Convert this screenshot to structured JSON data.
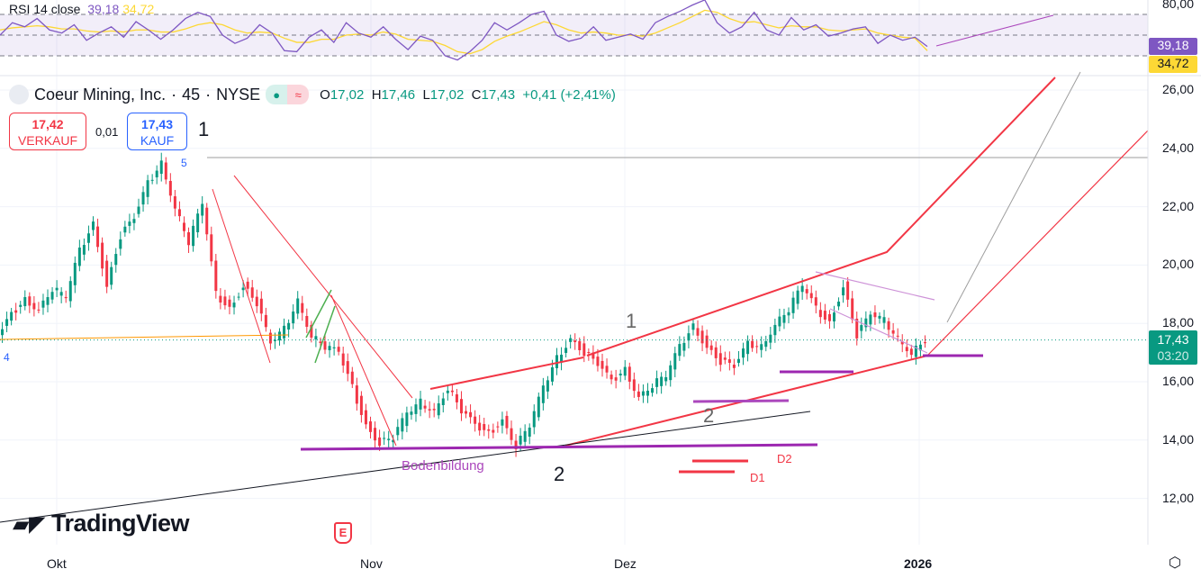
{
  "header": {
    "symbol": "Coeur Mining, Inc.",
    "interval": "45",
    "exchange": "NYSE",
    "separator": "·",
    "ohlc": {
      "o_label": "O",
      "o": "17,02",
      "h_label": "H",
      "h": "17,46",
      "l_label": "L",
      "l": "17,02",
      "c_label": "C",
      "c": "17,43",
      "change": "+0,41 (+2,41%)"
    }
  },
  "trade": {
    "sell_price": "17,42",
    "sell_label": "VERKAUF",
    "spread": "0,01",
    "buy_price": "17,43",
    "buy_label": "KAUF"
  },
  "rsi": {
    "title": "RSI 14 close",
    "value": "39,18",
    "ma": "34,72",
    "axis_top": "80,00",
    "levels": [
      70,
      50,
      30
    ],
    "values": [
      50,
      62,
      58,
      66,
      55,
      52,
      60,
      45,
      52,
      58,
      48,
      63,
      55,
      46,
      55,
      66,
      72,
      68,
      50,
      42,
      47,
      60,
      52,
      35,
      34,
      48,
      55,
      43,
      62,
      52,
      48,
      58,
      46,
      36,
      49,
      45,
      30,
      26,
      34,
      45,
      62,
      55,
      62,
      70,
      73,
      50,
      44,
      47,
      58,
      45,
      48,
      51,
      46,
      62,
      68,
      73,
      79,
      84,
      62,
      52,
      58,
      72,
      55,
      50,
      67,
      55,
      60,
      49,
      52,
      56,
      58,
      42,
      50,
      45,
      48,
      39
    ],
    "ma_values": [
      55,
      57,
      58,
      59,
      58,
      56,
      56,
      54,
      53,
      54,
      53,
      55,
      55,
      53,
      53,
      56,
      60,
      62,
      60,
      55,
      52,
      53,
      52,
      47,
      43,
      43,
      46,
      46,
      50,
      51,
      50,
      53,
      51,
      46,
      45,
      44,
      40,
      34,
      32,
      36,
      44,
      49,
      53,
      58,
      63,
      60,
      55,
      52,
      53,
      52,
      50,
      50,
      49,
      52,
      57,
      62,
      68,
      74,
      72,
      66,
      62,
      63,
      60,
      57,
      59,
      58,
      58,
      55,
      54,
      55,
      56,
      52,
      50,
      48,
      47,
      35
    ]
  },
  "price": {
    "last": "17,43",
    "countdown": "03:20",
    "axis_labels": [
      "26,00",
      "24,00",
      "22,00",
      "20,00",
      "18,00",
      "16,00",
      "14,00",
      "12,00"
    ]
  },
  "chart_data": {
    "type": "candlestick",
    "title": "Coeur Mining, Inc. · 45 · NYSE",
    "ylim": [
      10.6,
      27.2
    ],
    "x_labels": [
      "Okt",
      "Nov",
      "Dez",
      "2026"
    ],
    "closes": [
      17.5,
      18.3,
      18.8,
      18.5,
      19.2,
      18.9,
      20.5,
      21.4,
      19.3,
      21.0,
      21.6,
      22.8,
      23.5,
      22.0,
      20.8,
      22.1,
      19.0,
      18.5,
      19.3,
      18.7,
      17.3,
      17.8,
      18.8,
      17.6,
      17.2,
      17.0,
      15.8,
      14.5,
      13.9,
      14.1,
      14.9,
      15.3,
      15.0,
      15.8,
      15.0,
      14.5,
      14.2,
      14.7,
      13.8,
      14.5,
      15.8,
      16.8,
      17.5,
      17.0,
      16.6,
      16.0,
      16.4,
      15.5,
      15.9,
      16.2,
      17.2,
      17.9,
      17.2,
      16.7,
      16.5,
      17.3,
      17.2,
      18.0,
      18.5,
      19.3,
      18.5,
      18.0,
      19.3,
      17.6,
      18.3,
      18.1,
      17.5,
      17.0,
      17.43
    ],
    "annotations": [
      "5",
      "4",
      "1",
      "1",
      "2",
      "2",
      "Bodenbildung",
      "D2",
      "D1"
    ]
  },
  "branding": {
    "logo": "TradingView",
    "earnings_marker": "E"
  },
  "colors": {
    "up": "#089981",
    "down": "#f23645",
    "rsi": "#7e57c2",
    "rsi_ma": "#fdd835",
    "channel": "#f23645",
    "support": "#9c27b0"
  }
}
